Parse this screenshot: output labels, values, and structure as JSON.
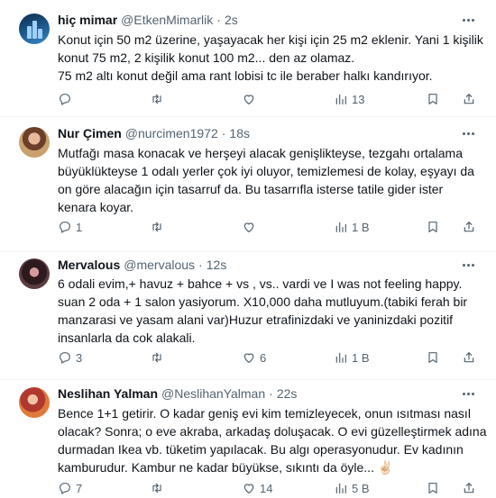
{
  "tweets": [
    {
      "name": "hiç mimar",
      "handle": "@EtkenMimarlik",
      "dot": "·",
      "time": "2s",
      "lines": [
        "Konut için 50 m2 üzerine, yaşayacak her kişi için 25 m2 eklenir. Yani 1 kişilik",
        "konut 75 m2, 2 kişilik konut 100 m2... den az olamaz.",
        "75 m2 altı konut değil ama rant lobisi tc ile beraber halkı kandırıyor."
      ],
      "replies": "",
      "retweets": "",
      "likes": "",
      "views": "13"
    },
    {
      "name": "Nur Çimen",
      "handle": "@nurcimen1972",
      "dot": "·",
      "time": "18s",
      "lines": [
        "Mutfağı masa konacak ve herşeyi alacak genişlikteyse, tezgahı ortalama",
        "büyüklükteyse  1 odalı yerler çok iyi oluyor,  temizlemesi de kolay,  eşyayı da",
        "on göre alacağın için tasarruf da. Bu tasarrıfla isterse tatile gider ister",
        "kenara koyar."
      ],
      "replies": "1",
      "retweets": "",
      "likes": "",
      "views": "1 B"
    },
    {
      "name": "Mervalous",
      "handle": "@mervalous",
      "dot": "·",
      "time": "12s",
      "lines": [
        "6 odali evim,+ havuz + bahce + vs , vs.. vardi ve I was not feeling happy.",
        "suan 2 oda + 1 salon yasiyorum. X10,000 daha mutluyum.(tabiki ferah bir",
        "manzarasi ve yasam alani var)Huzur etrafinizdaki ve yaninizdaki pozitif",
        "insanlarla da cok alakali."
      ],
      "replies": "3",
      "retweets": "",
      "likes": "6",
      "views": "1 B"
    },
    {
      "name": "Neslihan Yalman",
      "handle": "@NeslihanYalman",
      "dot": "·",
      "time": "22s",
      "lines": [
        "Bence 1+1 getirir. O kadar geniş evi kim temizleyecek, onun ısıtması nasıl",
        "olacak? Sonra; o eve akraba, arkadaş doluşacak. O evi güzelleştirmek adına",
        "durmadan Ikea vb. tüketim yapılacak. Bu algı operasyonudur. Ev kadının",
        "kamburudur.  Kambur ne kadar büyükse, sıkıntı da öyle... ✌🏻"
      ],
      "replies": "7",
      "retweets": "",
      "likes": "14",
      "views": "5 B"
    }
  ],
  "icons": {
    "reply": "reply-icon",
    "retweet": "retweet-icon",
    "like": "heart-icon",
    "views": "views-icon",
    "bookmark": "bookmark-icon",
    "share": "share-icon",
    "more": "more-icon"
  },
  "colors": {
    "text": "#0f1419",
    "secondary": "#536471",
    "divider": "#eff3f4"
  }
}
